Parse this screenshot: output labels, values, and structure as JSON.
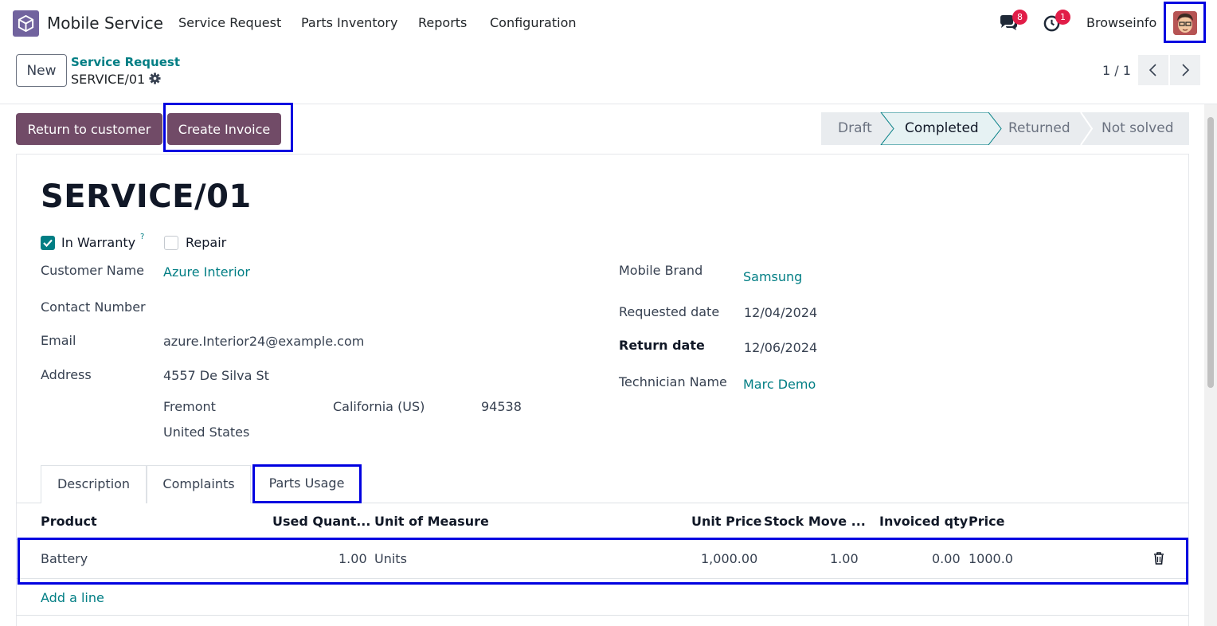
{
  "navbar": {
    "app_name": "Mobile Service",
    "menu": [
      "Service Request",
      "Parts Inventory",
      "Reports",
      "Configuration"
    ],
    "messages_badge": "8",
    "activities_badge": "1",
    "user_name": "Browseinfo"
  },
  "control_panel": {
    "new_label": "New",
    "breadcrumb_parent": "Service Request",
    "breadcrumb_current": "SERVICE/01",
    "pager": "1 / 1"
  },
  "actions": {
    "return_label": "Return to customer",
    "invoice_label": "Create Invoice"
  },
  "stages": [
    "Draft",
    "Completed",
    "Returned",
    "Not solved"
  ],
  "active_stage": "Completed",
  "record": {
    "title": "SERVICE/01",
    "in_warranty_label": "In Warranty",
    "in_warranty_help": "?",
    "repair_label": "Repair",
    "customer_name_label": "Customer Name",
    "customer_name": "Azure Interior",
    "contact_number_label": "Contact Number",
    "email_label": "Email",
    "email": "azure.Interior24@example.com",
    "address_label": "Address",
    "street": "4557 De Silva St",
    "city": "Fremont",
    "state": "California (US)",
    "zip": "94538",
    "country": "United States",
    "mobile_brand_label": "Mobile Brand",
    "mobile_brand": "Samsung",
    "requested_date_label": "Requested date",
    "requested_date": "12/04/2024",
    "return_date_label": "Return date",
    "return_date": "12/06/2024",
    "technician_label": "Technician Name",
    "technician": "Marc Demo"
  },
  "tabs": [
    "Description",
    "Complaints",
    "Parts Usage"
  ],
  "table": {
    "columns": [
      "Product",
      "Used Quant...",
      "Unit of Measure",
      "Unit Price",
      "Stock Move ...",
      "Invoiced qty",
      "Price"
    ],
    "rows": [
      {
        "product": "Battery",
        "used_qty": "1.00",
        "uom": "Units",
        "unit_price": "1,000.00",
        "stock_move": "1.00",
        "invoiced_qty": "0.00",
        "price": "1000.0"
      }
    ],
    "add_line": "Add a line"
  },
  "colors": {
    "primary": "#714b67",
    "link": "#017e84",
    "highlight": "#0000e0"
  }
}
